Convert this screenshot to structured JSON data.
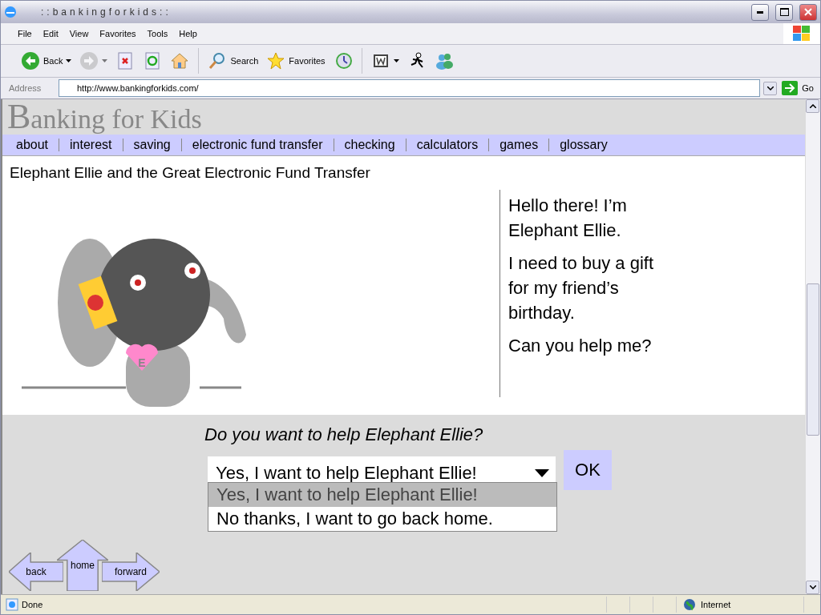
{
  "window": {
    "title": "::bankingforkids::"
  },
  "menu": [
    "File",
    "Edit",
    "View",
    "Favorites",
    "Tools",
    "Help"
  ],
  "toolbar": [
    {
      "kind": "back",
      "label": "Back",
      "dropdown": true,
      "disabled": false
    },
    {
      "kind": "forward",
      "dropdown": true,
      "disabled": true
    },
    {
      "kind": "stop",
      "dropdown": false,
      "disabled": false
    },
    {
      "kind": "refresh",
      "dropdown": false,
      "disabled": false
    },
    {
      "kind": "home",
      "dropdown": false,
      "disabled": false
    },
    {
      "kind": "separator"
    },
    {
      "kind": "search",
      "label": "Search",
      "dropdown": false,
      "disabled": false
    },
    {
      "kind": "favorites",
      "label": "Favorites",
      "dropdown": false,
      "disabled": false
    },
    {
      "kind": "history",
      "dropdown": false,
      "disabled": false
    },
    {
      "kind": "separator"
    },
    {
      "kind": "word",
      "dropdown": true,
      "disabled": false
    },
    {
      "kind": "runner",
      "dropdown": false,
      "disabled": false
    },
    {
      "kind": "messenger",
      "dropdown": false,
      "disabled": false
    }
  ],
  "address": {
    "label": "Address",
    "value": "http://www.bankingforkids.com/",
    "go": "Go"
  },
  "page": {
    "logo": "Banking for Kids",
    "nav": [
      "about",
      "interest",
      "saving",
      "electronic fund transfer",
      "checking",
      "calculators",
      "games",
      "glossary"
    ],
    "heading": "Elephant Ellie and the Great Electronic Fund Transfer",
    "badge_letter": "E",
    "speech": [
      "Hello there! I’m Elephant Ellie.",
      "I need to buy a gift for my friend’s birthday.",
      "Can you help me?"
    ],
    "question": "Do you want to help Elephant Ellie?",
    "select": {
      "value": "Yes, I want to help Elephant Ellie!",
      "expanded": true,
      "options": [
        {
          "label": "Yes, I want to help Elephant Ellie!",
          "selected": true
        },
        {
          "label": "No thanks, I want to go back home.",
          "selected": false
        }
      ]
    },
    "ok": "OK",
    "arrows": [
      {
        "kind": "left",
        "label": "back"
      },
      {
        "kind": "up",
        "label": "home"
      },
      {
        "kind": "right",
        "label": "forward"
      }
    ]
  },
  "status_bar": {
    "text": "Done",
    "zone": "Internet"
  }
}
